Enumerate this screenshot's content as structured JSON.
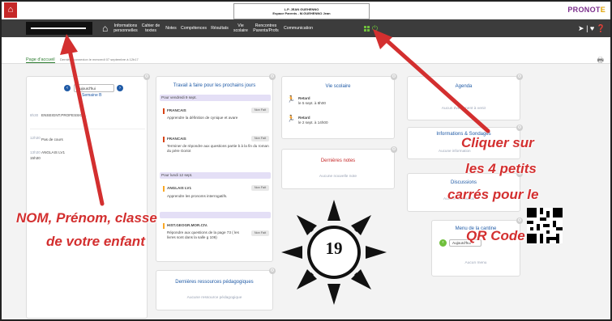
{
  "app": {
    "school_name": "L.P. JEAN GUEHENNO",
    "space_label": "Espace Parents - M.GUEHENNO Jean",
    "brand_main": "PRONOT",
    "brand_accent": "E"
  },
  "nav": {
    "items": [
      "Informations personnelles",
      "Cahier de textes",
      "Notes",
      "Compétences",
      "Résultats",
      "Vie scolaire",
      "Rencontres Parents/Profs",
      "Communication"
    ]
  },
  "subbar": {
    "tab": "Page d'accueil",
    "last_login": "Dernière connexion le mercredi 07 septembre à 12h17"
  },
  "edt": {
    "day": "Aujourd'hui",
    "week": "Semaine B",
    "rows": [
      {
        "time": "8h30",
        "text": "ENSEIGNT.PROFESSION."
      },
      {
        "time": "12h30",
        "text": "Pas de cours"
      },
      {
        "time": "13h30",
        "text": "ANGLAIS LV1"
      },
      {
        "time": "15h30",
        "text": ""
      }
    ]
  },
  "travail": {
    "title": "Travail à faire pour les prochains jours",
    "groups": [
      {
        "date": "Pour vendredi 9 sept.",
        "items": [
          {
            "subject": "FRANCAIS",
            "status": "Non Fait",
            "text": "Apprendre la définition de cynique et avare",
            "color": "#d84315"
          },
          {
            "subject": "FRANCAIS",
            "status": "Non Fait",
            "text": "Terminer de répondre aux questions partie b à la fin du roman du père Goriot",
            "color": "#d84315"
          }
        ]
      },
      {
        "date": "Pour lundi 12 sept.",
        "items": [
          {
            "subject": "ANGLAIS LV1",
            "status": "Non Fait",
            "text": "Apprendre les pronoms interrogatifs.",
            "color": "#f9a825"
          },
          {
            "subject": "HIST.GEOGR.MOR.CIV.",
            "status": "Non Fait",
            "text": "Répondre aux questions de la page 73 ( les livres sont dans la salle g 106)",
            "color": "#f9a825"
          }
        ]
      }
    ]
  },
  "vie_scolaire": {
    "title": "Vie scolaire",
    "items": [
      {
        "label": "Retard",
        "detail": "le 5 sept. à 8h00"
      },
      {
        "label": "Retard",
        "detail": "le 2 sept. à 14h00"
      }
    ]
  },
  "notes": {
    "title": "Dernières notes",
    "empty": "Aucune nouvelle note"
  },
  "ressources": {
    "title": "Dernières ressources pédagogiques",
    "empty": "Aucune ressource pédagogique"
  },
  "agenda": {
    "title": "Agenda",
    "empty": "Aucun événement à venir"
  },
  "sondages": {
    "title": "Informations & Sondages",
    "empty": "Aucune information"
  },
  "discussions": {
    "title": "Discussions",
    "empty": "Aucune discussion"
  },
  "cantine": {
    "title": "Menu de la cantine",
    "day": "Aujourd'hui",
    "empty": "Aucun menu"
  },
  "annotations": {
    "name_line1": "NOM, Prénom, classe",
    "name_line2": "de votre enfant",
    "qr_line1": "Cliquer sur",
    "qr_line2": "les 4 petits",
    "qr_line3": "carrés pour le",
    "qr_line4": "QR Code",
    "page_number": "19"
  },
  "colors": {
    "accent_green": "#6fbf3c",
    "nav_dark": "#3c3c3c",
    "annotation_red": "#d32f2f",
    "link_blue": "#1f5aa6"
  }
}
